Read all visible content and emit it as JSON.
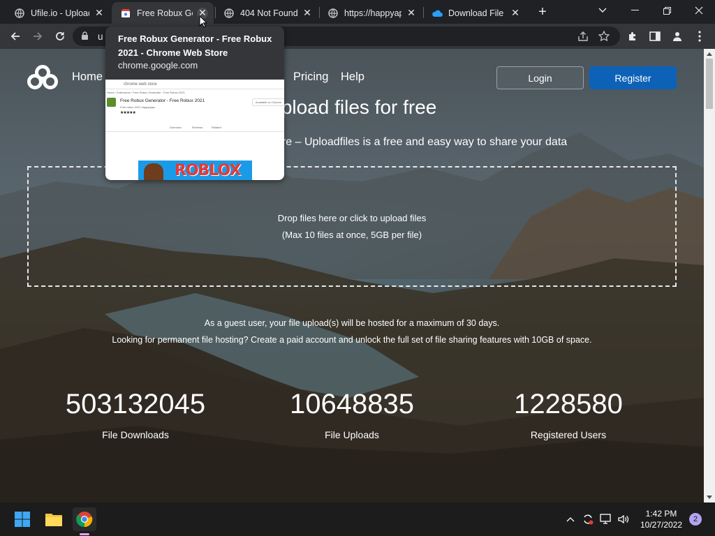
{
  "browser": {
    "tabs": [
      {
        "title": "Ufile.io - Upload",
        "favicon": "globe-icon",
        "active": false
      },
      {
        "title": "Free Robux Generator - Free Robux 2021 - Chrome Web Store",
        "favicon": "chrome-web-store-icon",
        "active": true
      },
      {
        "title": "404 Not Found",
        "favicon": "globe-icon",
        "active": false
      },
      {
        "title": "https://happyapps",
        "favicon": "globe-icon",
        "active": false
      },
      {
        "title": "Download File",
        "favicon": "cloud-icon",
        "active": false
      }
    ],
    "omnibox_partial": "u",
    "hover_card": {
      "title": "Free Robux Generator - Free Robux 2021 - Chrome Web Store",
      "domain": "chrome.google.com",
      "preview": {
        "store_label": "chrome web store",
        "breadcrumb": "Home  ›  Extensions  ›  Free Robux Generator - Free Robux 2021",
        "item_title": "Free Robux Generator - Free Robux 2021",
        "item_sub": "Free robux 2021 happyapps",
        "action": "Available on Chrome",
        "tabs": [
          "Overview",
          "Reviews",
          "Related"
        ],
        "banner": "ROBLOX"
      }
    }
  },
  "page": {
    "nav": [
      "Home",
      "Pricing",
      "Help"
    ],
    "login_label": "Login",
    "register_label": "Register",
    "hero_title": "Upload files for free",
    "hero_subtitle": "Share photos, videos and more – Uploadfiles is a free and easy way to share your data",
    "dropzone": {
      "line1": "Drop files here or click to upload files",
      "line2": "(Max 10 files at once, 5GB per file)"
    },
    "guest_line1": "As a guest user, your file upload(s) will be hosted for a maximum of 30 days.",
    "guest_line2": "Looking for permanent file hosting? Create a paid account and unlock the full set of file sharing features with 10GB of space.",
    "stats": [
      {
        "value": "503132045",
        "label": "File Downloads"
      },
      {
        "value": "10648835",
        "label": "File Uploads"
      },
      {
        "value": "1228580",
        "label": "Registered Users"
      }
    ]
  },
  "taskbar": {
    "apps": [
      "windows-start-icon",
      "file-explorer-icon",
      "chrome-icon"
    ],
    "time": "1:42 PM",
    "date": "10/27/2022",
    "notification_count": "2"
  },
  "colors": {
    "register": "#0d62b8",
    "tab_active": "#35363a",
    "chrome_dark": "#202124"
  }
}
